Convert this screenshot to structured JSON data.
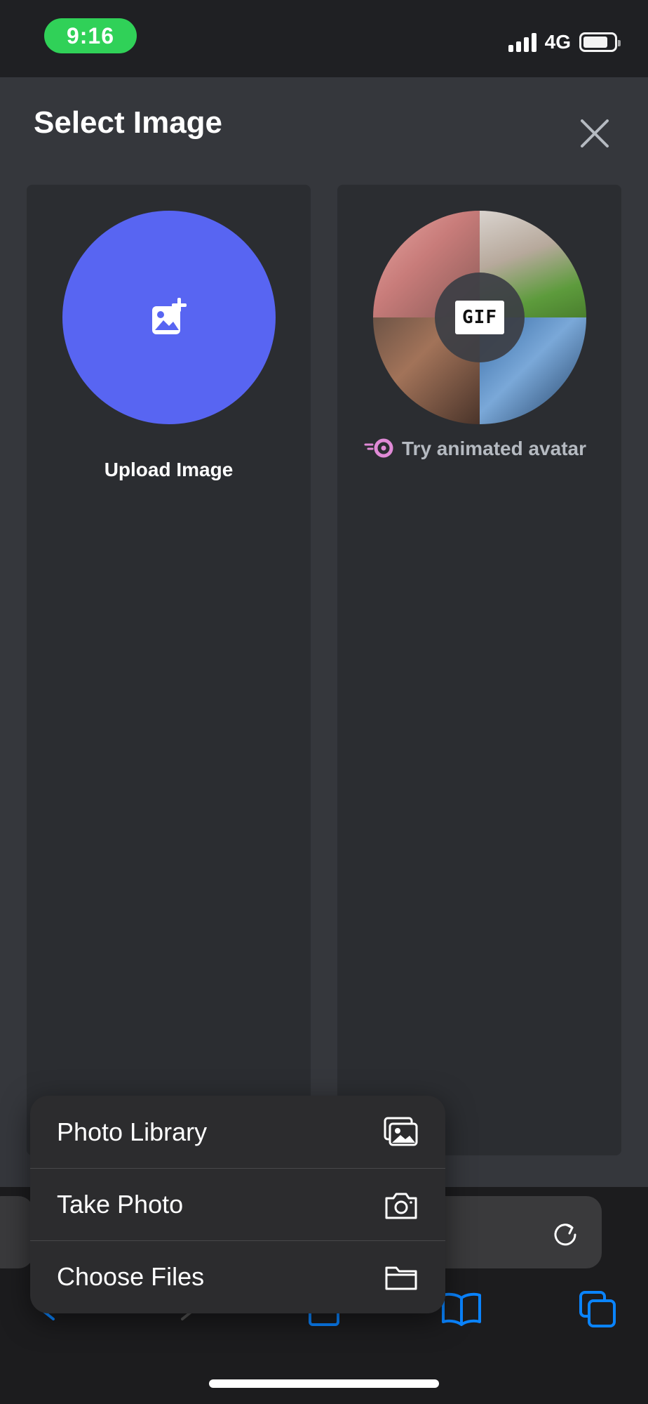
{
  "status_bar": {
    "time": "9:16",
    "network": "4G"
  },
  "modal": {
    "title": "Select Image",
    "close_icon": "close-icon",
    "upload_card": {
      "label": "Upload Image",
      "icon": "image-add-icon",
      "color": "#5865f2"
    },
    "gif_card": {
      "badge": "GIF",
      "promo_text": "Try animated avatar",
      "icon": "nitro-icon",
      "icon_color": "#e08ad6"
    }
  },
  "action_menu": {
    "items": [
      {
        "label": "Photo Library",
        "icon": "photo-library-icon"
      },
      {
        "label": "Take Photo",
        "icon": "camera-icon"
      },
      {
        "label": "Choose Files",
        "icon": "folder-icon"
      }
    ]
  },
  "browser_toolbar": {
    "accent": "#0a84ff",
    "icons": [
      "back-icon",
      "forward-icon",
      "share-icon",
      "bookmarks-icon",
      "tabs-icon",
      "reload-icon"
    ]
  }
}
